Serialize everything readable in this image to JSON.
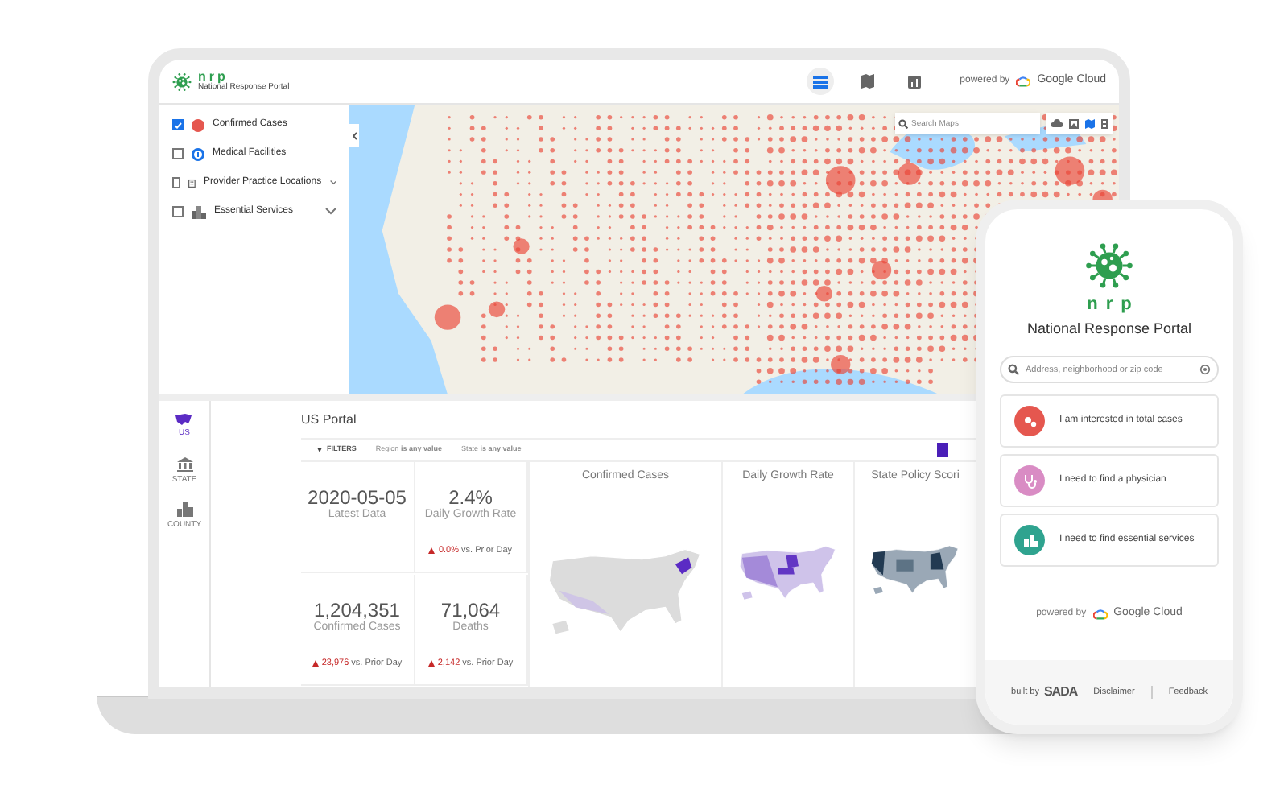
{
  "laptop": {
    "header": {
      "logo_text": "nrp",
      "logo_subtitle": "National Response Portal",
      "view_buttons": [
        {
          "selected": true
        },
        {
          "selected": false
        },
        {
          "selected": false
        }
      ],
      "powered_by": "powered by",
      "brand": "Google Cloud"
    },
    "layers": [
      {
        "label": "Confirmed Cases",
        "checked": true,
        "expandable": false
      },
      {
        "label": "Medical Facilities",
        "checked": false,
        "expandable": false
      },
      {
        "label": "Provider Practice Locations",
        "checked": false,
        "expandable": true
      },
      {
        "label": "Essential Services",
        "checked": false,
        "expandable": true
      }
    ],
    "map": {
      "search_placeholder": "Search Maps"
    },
    "nav": [
      {
        "label": "US",
        "selected": true
      },
      {
        "label": "STATE",
        "selected": false
      },
      {
        "label": "COUNTY",
        "selected": false
      }
    ],
    "portal_title": "US Portal",
    "filters": {
      "label": "FILTERS",
      "items": [
        "Region **is any value**",
        "State **is any value**"
      ]
    },
    "stats": [
      {
        "value": "2020-05-05",
        "label": "Latest Data"
      },
      {
        "value": "2.4%",
        "label": "Daily Growth Rate",
        "change": "0.0%",
        "change_note": "vs. Prior Day"
      },
      {
        "value": "1,204,351",
        "label": "Confirmed Cases",
        "change": "23,976",
        "change_note": "vs. Prior Day"
      },
      {
        "value": "71,064",
        "label": "Deaths",
        "change": "2,142",
        "change_note": "vs. Prior Day"
      }
    ],
    "map_panels": [
      {
        "title": "Confirmed Cases"
      },
      {
        "title": "Daily Growth Rate"
      },
      {
        "title": "State Policy Scori"
      }
    ]
  },
  "phone": {
    "logo_text": "nrp",
    "title": "National Response Portal",
    "search_placeholder": "Address, neighborhood or zip code",
    "options": [
      {
        "label": "I am interested in total cases",
        "color": "#e5574f"
      },
      {
        "label": "I need to find a physician",
        "color": "#d98cc4"
      },
      {
        "label": "I need to find essential services",
        "color": "#2fa38f"
      }
    ],
    "powered_by": "powered by",
    "brand": "Google Cloud",
    "footer": {
      "built_by": "built by",
      "maker": "SADA",
      "links": [
        "Disclaimer",
        "Feedback"
      ]
    }
  }
}
